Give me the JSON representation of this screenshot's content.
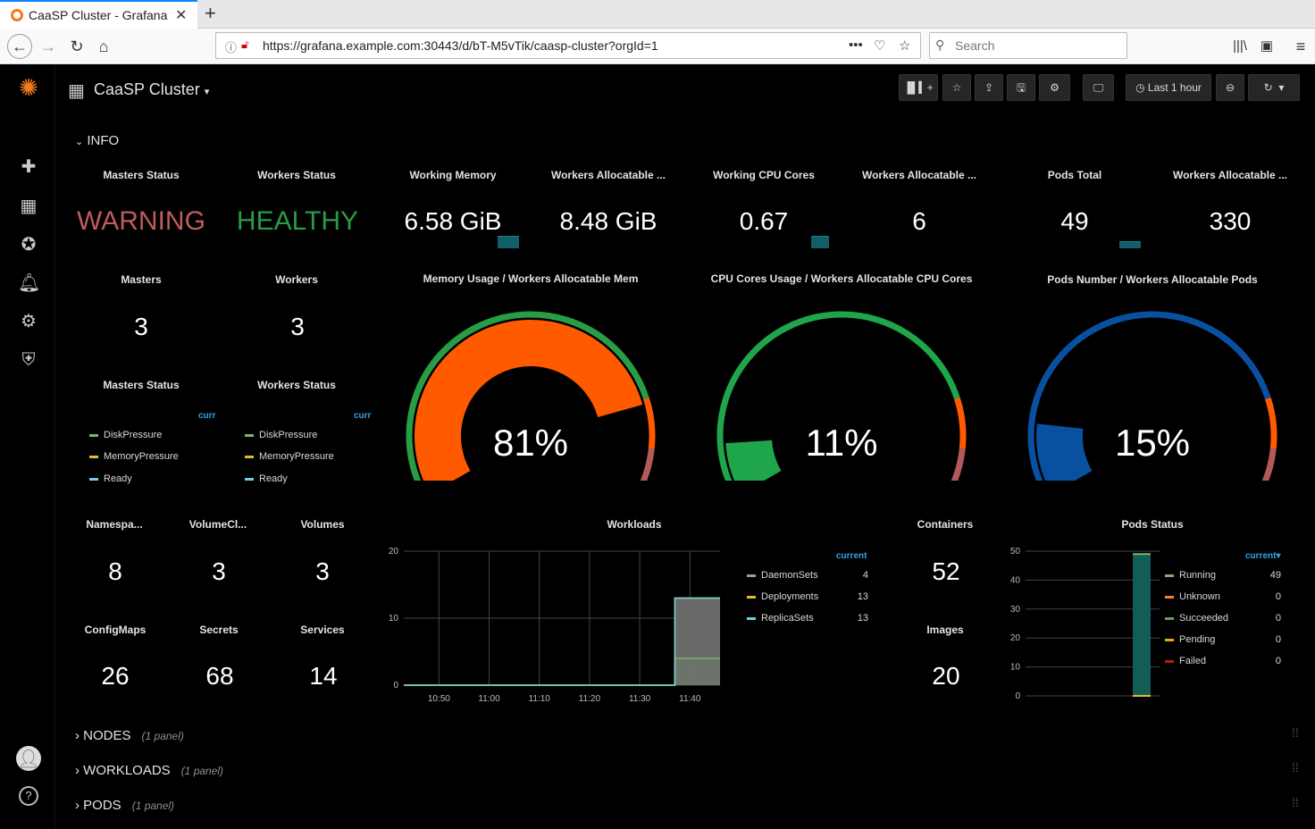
{
  "browser": {
    "tab_title": "CaaSP Cluster - Grafana",
    "url": "https://grafana.example.com:30443/d/bT-M5vTik/caasp-cluster?orgId=1",
    "search_placeholder": "Search"
  },
  "dashboard": {
    "title": "CaaSP Cluster",
    "time_range": "Last 1 hour"
  },
  "rows": {
    "info": "INFO",
    "nodes": "NODES",
    "nodes_count": "(1 panel)",
    "workloads": "WORKLOADS",
    "workloads_count": "(1 panel)",
    "pods": "PODS",
    "pods_count": "(1 panel)"
  },
  "stats": {
    "masters_status": {
      "title": "Masters Status",
      "value": "WARNING",
      "color": "#bf5b5b"
    },
    "workers_status": {
      "title": "Workers Status",
      "value": "HEALTHY",
      "color": "#299c46"
    },
    "working_memory": {
      "title": "Working Memory",
      "value": "6.58 GiB"
    },
    "workers_alloc_mem": {
      "title": "Workers Allocatable ...",
      "value": "8.48 GiB"
    },
    "working_cpu": {
      "title": "Working CPU Cores",
      "value": "0.67"
    },
    "workers_alloc_cpu": {
      "title": "Workers Allocatable ...",
      "value": "6"
    },
    "pods_total": {
      "title": "Pods Total",
      "value": "49"
    },
    "workers_alloc_pods": {
      "title": "Workers Allocatable ...",
      "value": "330"
    },
    "masters": {
      "title": "Masters",
      "value": "3"
    },
    "workers": {
      "title": "Workers",
      "value": "3"
    },
    "namespaces": {
      "title": "Namespa...",
      "value": "8"
    },
    "volumeclaims": {
      "title": "VolumeCl...",
      "value": "3"
    },
    "volumes": {
      "title": "Volumes",
      "value": "3"
    },
    "configmaps": {
      "title": "ConfigMaps",
      "value": "26"
    },
    "secrets": {
      "title": "Secrets",
      "value": "68"
    },
    "services": {
      "title": "Services",
      "value": "14"
    },
    "containers": {
      "title": "Containers",
      "value": "52"
    },
    "images": {
      "title": "Images",
      "value": "20"
    }
  },
  "conditions": {
    "masters": {
      "title": "Masters Status",
      "header": "curr",
      "items": [
        "DiskPressure",
        "MemoryPressure",
        "Ready"
      ]
    },
    "workers": {
      "title": "Workers Status",
      "header": "curr",
      "items": [
        "DiskPressure",
        "MemoryPressure",
        "Ready"
      ]
    }
  },
  "gauges": {
    "memory": {
      "title": "Memory Usage / Workers Allocatable Mem",
      "value": "81%",
      "fraction": 0.81,
      "color": "#ff5a00"
    },
    "cpu": {
      "title": "CPU Cores Usage / Workers Allocatable CPU Cores",
      "value": "11%",
      "fraction": 0.11,
      "color": "#1fa64a"
    },
    "pods": {
      "title": "Pods Number / Workers Allocatable Pods",
      "value": "15%",
      "fraction": 0.15,
      "color": "#0a50a1"
    }
  },
  "workloads": {
    "title": "Workloads",
    "legend_header": "current",
    "legend": [
      {
        "name": "DaemonSets",
        "current": "4",
        "color": "#7eb26d"
      },
      {
        "name": "Deployments",
        "current": "13",
        "color": "#eab839"
      },
      {
        "name": "ReplicaSets",
        "current": "13",
        "color": "#6ed0e0"
      }
    ]
  },
  "pods_status": {
    "title": "Pods Status",
    "legend_header": "current▾",
    "legend": [
      {
        "name": "Running",
        "current": "49",
        "color": "#7eb26d"
      },
      {
        "name": "Unknown",
        "current": "0",
        "color": "#ef843c"
      },
      {
        "name": "Succeeded",
        "current": "0",
        "color": "#629e51"
      },
      {
        "name": "Pending",
        "current": "0",
        "color": "#e5ac0e"
      },
      {
        "name": "Failed",
        "current": "0",
        "color": "#bf1b00"
      }
    ]
  },
  "chart_data": [
    {
      "type": "area",
      "title": "Workloads",
      "x_ticks": [
        "10:50",
        "11:00",
        "11:10",
        "11:20",
        "11:30",
        "11:40"
      ],
      "y_ticks": [
        "0",
        "10",
        "20"
      ],
      "ylim": [
        0,
        20
      ],
      "series": [
        {
          "name": "DaemonSets",
          "x": [
            "10:43",
            "11:37",
            "11:37",
            "11:46"
          ],
          "values": [
            0,
            0,
            4,
            4
          ]
        },
        {
          "name": "Deployments",
          "x": [
            "10:43",
            "11:37",
            "11:37",
            "11:46"
          ],
          "values": [
            0,
            0,
            13,
            13
          ]
        },
        {
          "name": "ReplicaSets",
          "x": [
            "10:43",
            "11:37",
            "11:37",
            "11:46"
          ],
          "values": [
            0,
            0,
            13,
            13
          ]
        }
      ]
    },
    {
      "type": "bar",
      "title": "Pods Status",
      "y_ticks": [
        "0",
        "10",
        "20",
        "30",
        "40",
        "50"
      ],
      "ylim": [
        0,
        50
      ],
      "series": [
        {
          "name": "Running",
          "values": [
            49
          ]
        },
        {
          "name": "Unknown",
          "values": [
            0
          ]
        },
        {
          "name": "Succeeded",
          "values": [
            0
          ]
        },
        {
          "name": "Pending",
          "values": [
            0
          ]
        },
        {
          "name": "Failed",
          "values": [
            0
          ]
        }
      ]
    }
  ]
}
